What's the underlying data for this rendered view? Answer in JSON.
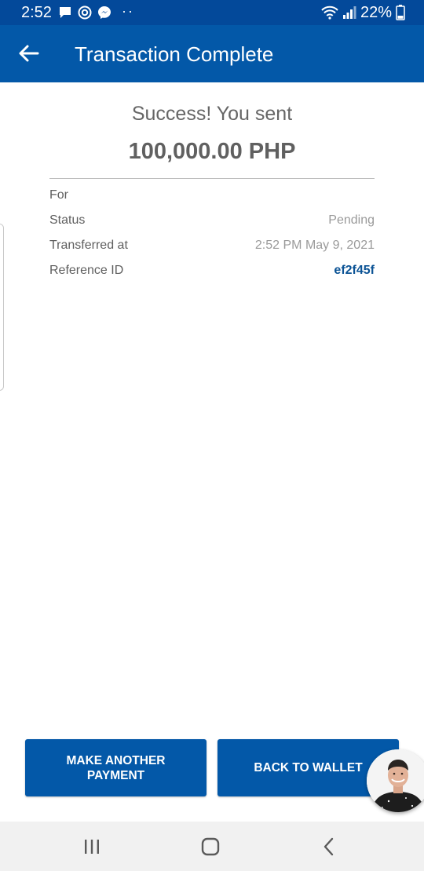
{
  "status_bar": {
    "time": "2:52",
    "dots": "··",
    "battery": "22%",
    "icons": [
      "chat-notification-icon",
      "viber-icon",
      "messenger-icon",
      "wifi-icon",
      "signal-icon",
      "battery-icon"
    ]
  },
  "app_bar": {
    "title": "Transaction Complete",
    "back_icon": "back-arrow-icon"
  },
  "summary": {
    "success_text": "Success! You sent",
    "amount": "100,000.00 PHP"
  },
  "details": [
    {
      "label": "For",
      "value": ""
    },
    {
      "label": "Status",
      "value": "Pending"
    },
    {
      "label": "Transferred at",
      "value": "2:52 PM May 9, 2021"
    },
    {
      "label": "Reference ID",
      "value": "ef2f45f"
    }
  ],
  "actions": {
    "make_another": "MAKE ANOTHER PAYMENT",
    "back_to_wallet": "BACK TO WALLET"
  },
  "chat_head": {
    "icon": "avatar-chat-head"
  },
  "nav_bar": {
    "icons": [
      "recent-apps-icon",
      "home-icon",
      "back-icon"
    ]
  },
  "colors": {
    "status_bar": "#03499a",
    "app_bar": "#0358a8",
    "button": "#0358a8",
    "reference_id": "#0b5395"
  }
}
